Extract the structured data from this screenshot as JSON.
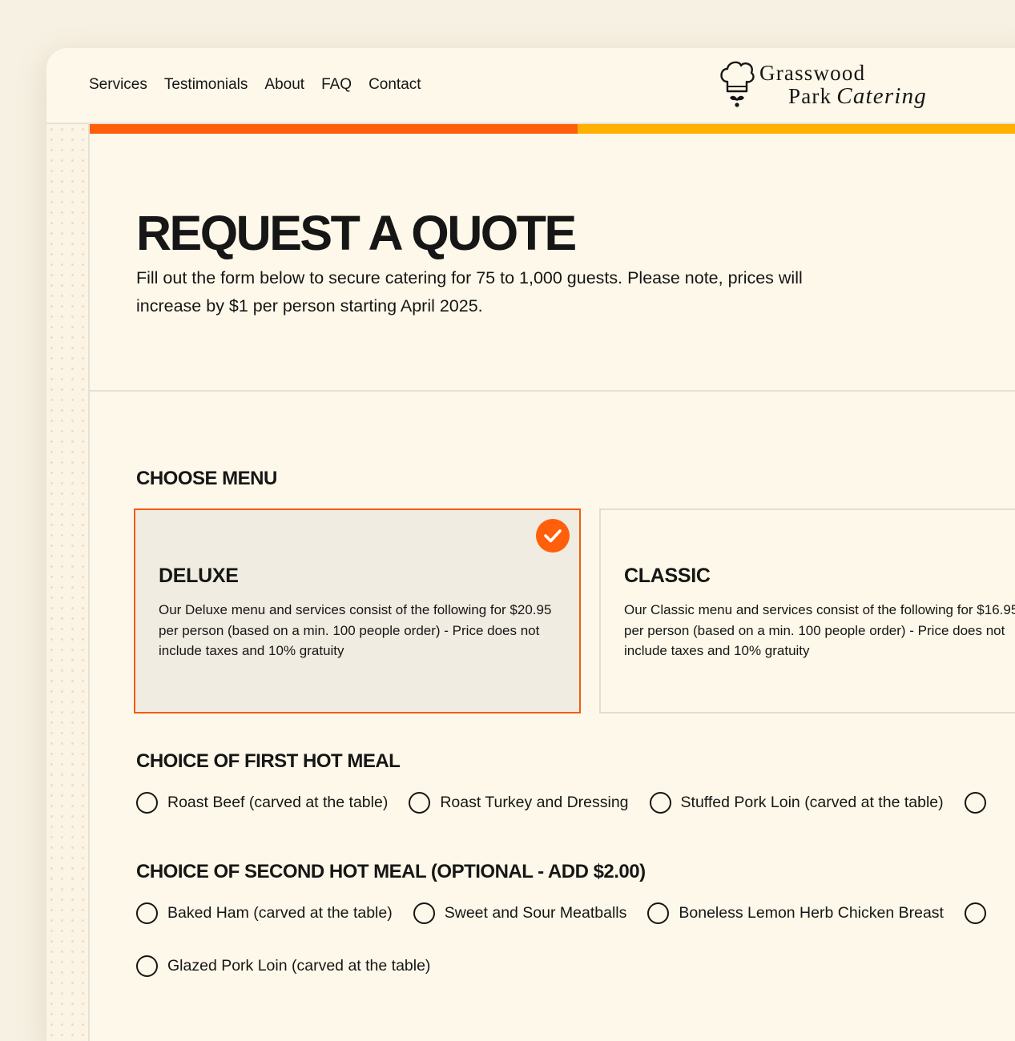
{
  "nav": {
    "links": [
      "Services",
      "Testimonials",
      "About",
      "FAQ",
      "Contact"
    ]
  },
  "logo": {
    "line1": "Grasswood",
    "line2": "Park",
    "script": "Catering",
    "icon": "chef-hat-mustache-icon"
  },
  "colors": {
    "accent_orange": "#ff5f0a",
    "accent_yellow": "#ffb000",
    "background": "#fdf8e9",
    "selected_card": "#f0ece1"
  },
  "hero": {
    "title": "REQUEST A QUOTE",
    "description": "Fill out the form below to secure catering for 75 to 1,000 guests. Please note, prices will increase by $1 per person starting April 2025."
  },
  "menu": {
    "title": "CHOOSE MENU",
    "options": [
      {
        "name": "DELUXE",
        "description": "Our Deluxe menu and services consist of the following for $20.95 per person (based on a min. 100 people order) - Price does not include taxes and 10% gratuity",
        "selected": true
      },
      {
        "name": "CLASSIC",
        "description": "Our Classic menu and services consist of the following for $16.95 per person (based on a min. 100 people order) - Price does not include taxes and 10% gratuity",
        "selected": false
      }
    ]
  },
  "first_meal": {
    "title": "CHOICE OF FIRST HOT MEAL",
    "options": [
      "Roast Beef (carved at the table)",
      "Roast Turkey and Dressing",
      "Stuffed Pork Loin (carved at the table)"
    ]
  },
  "second_meal": {
    "title": "CHOICE OF SECOND HOT MEAL (OPTIONAL - ADD $2.00)",
    "options": [
      "Baked Ham (carved at the table)",
      "Sweet and Sour Meatballs",
      "Boneless Lemon Herb Chicken Breast",
      "Glazed Pork Loin (carved at the table)"
    ]
  }
}
